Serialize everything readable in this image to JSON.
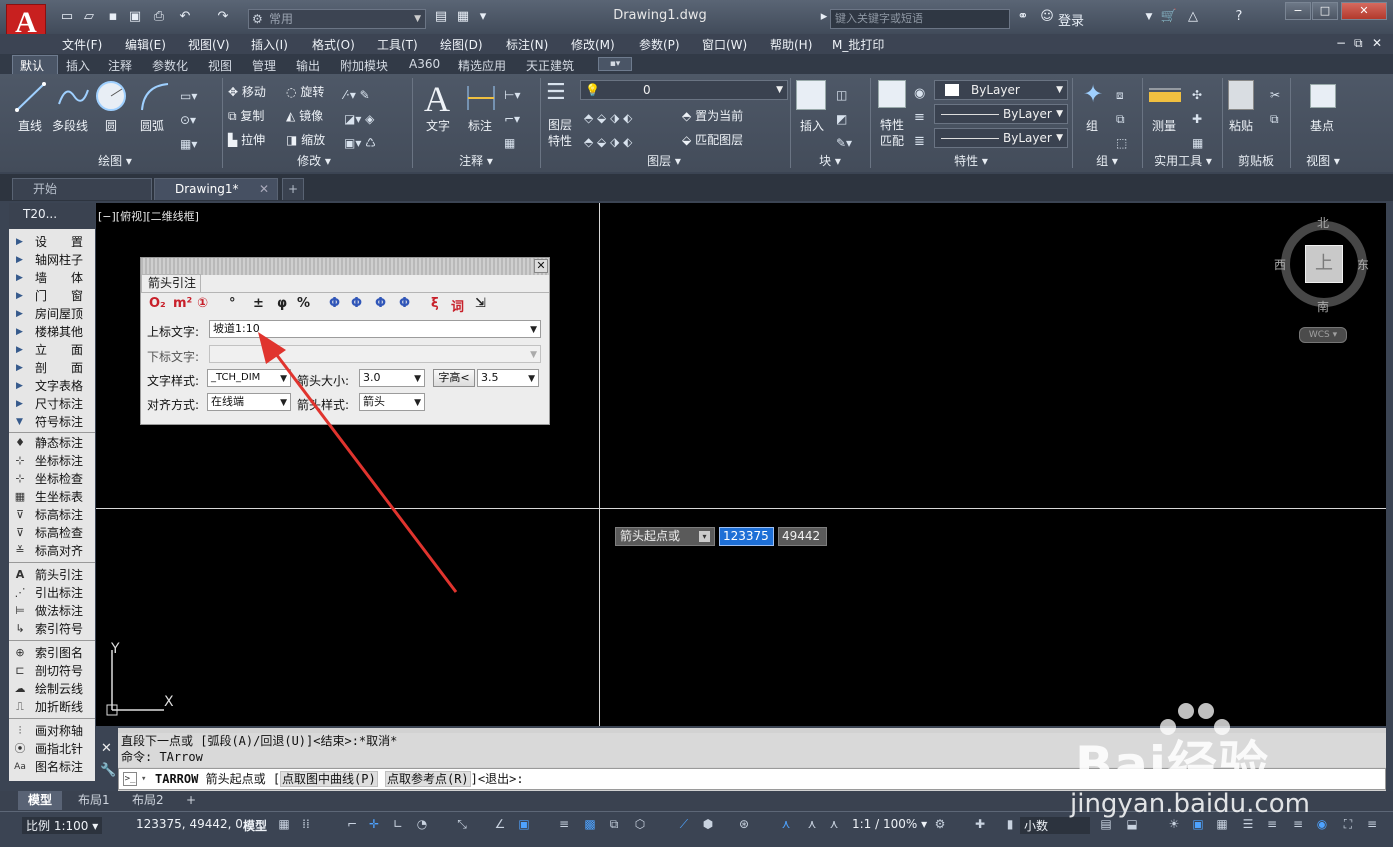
{
  "window": {
    "title": "Drawing1.dwg",
    "workspace": "常用",
    "search_placeholder": "键入关键字或短语",
    "login": "登录"
  },
  "menu": [
    "文件(F)",
    "编辑(E)",
    "视图(V)",
    "插入(I)",
    "格式(O)",
    "工具(T)",
    "绘图(D)",
    "标注(N)",
    "修改(M)",
    "参数(P)",
    "窗口(W)",
    "帮助(H)",
    "M_批打印"
  ],
  "ribbon_tabs": [
    "默认",
    "插入",
    "注释",
    "参数化",
    "视图",
    "管理",
    "输出",
    "附加模块",
    "A360",
    "精选应用",
    "天正建筑"
  ],
  "ribbon": {
    "draw": {
      "line": "直线",
      "polyline": "多段线",
      "circle": "圆",
      "arc": "圆弧",
      "panel": "绘图 ▾"
    },
    "modify": {
      "move": "移动",
      "rotate": "旋转",
      "copy": "复制",
      "mirror": "镜像",
      "stretch": "拉伸",
      "scale": "缩放",
      "panel": "修改 ▾"
    },
    "annot": {
      "text": "文字",
      "dim": "标注",
      "panel": "注释 ▾"
    },
    "layers": {
      "props": "图层\n特性",
      "current_layer": "0",
      "set_current": "置为当前",
      "match_layer": "匹配图层",
      "panel": "图层 ▾"
    },
    "block": {
      "insert": "插入",
      "panel": "块 ▾"
    },
    "properties": {
      "match": "特性\n匹配",
      "color": "ByLayer",
      "linetype": "ByLayer",
      "lineweight": "ByLayer",
      "panel": "特性 ▾"
    },
    "group": {
      "group": "组",
      "panel": "组 ▾"
    },
    "utilities": {
      "measure": "测量",
      "panel": "实用工具 ▾"
    },
    "clipboard": {
      "paste": "粘贴",
      "panel": "剪贴板"
    },
    "view": {
      "base": "基点",
      "panel": "视图 ▾"
    }
  },
  "doc_tabs": [
    "开始",
    "Drawing1*"
  ],
  "viewport_label": "[−][俯视][二维线框]",
  "palette": {
    "header": "T20...",
    "groups": [
      "设　　置",
      "轴网柱子",
      "墙　　体",
      "门　　窗",
      "房间屋顶",
      "楼梯其他",
      "立　　面",
      "剖　　面",
      "文字表格",
      "尺寸标注",
      "符号标注"
    ],
    "tools1": [
      "静态标注",
      "坐标标注",
      "坐标检查",
      "生坐标表",
      "标高标注",
      "标高检查",
      "标高对齐"
    ],
    "tools2": [
      "箭头引注",
      "引出标注",
      "做法标注",
      "索引符号"
    ],
    "tools3": [
      "索引图名",
      "剖切符号",
      "绘制云线",
      "加折断线"
    ],
    "tools4": [
      "画对称轴",
      "画指北针",
      "图名标注"
    ]
  },
  "dialog": {
    "title": "箭头引注",
    "symbols": [
      "O₂",
      "m²",
      "①",
      "°",
      "±",
      "φ",
      "%",
      "Φ",
      "Φ",
      "Φ",
      "Φ",
      "ξ",
      "词",
      "⇲"
    ],
    "upper_label": "上标文字:",
    "upper_value": "坡道1:10",
    "lower_label": "下标文字:",
    "lower_value": "",
    "text_style_label": "文字样式:",
    "text_style": "_TCH_DIM",
    "arrow_size_label": "箭头大小:",
    "arrow_size": "3.0",
    "font_height_btn": "字高<",
    "font_height": "3.5",
    "align_label": "对齐方式:",
    "align": "在线端",
    "arrow_style_label": "箭头样式:",
    "arrow_style": "箭头"
  },
  "cursor_tip": {
    "prompt": "箭头起点或",
    "x": "123375",
    "y": "49442"
  },
  "viewcube": {
    "n": "北",
    "s": "南",
    "e": "东",
    "w": "西",
    "face": "上",
    "wcs": "WCS ▾"
  },
  "ucs": {
    "x": "X",
    "y": "Y"
  },
  "command": {
    "history": [
      "直段下一点或 [弧段(A)/回退(U)]<结束>:*取消*",
      "命令: TArrow"
    ],
    "prompt_cmd": "TARROW",
    "prompt_text": "箭头起点或 [",
    "opt1": "点取图中曲线(P)",
    "opt2": "点取参考点(R)",
    "prompt_end": "]<退出>:"
  },
  "model_tabs": [
    "模型",
    "布局1",
    "布局2"
  ],
  "status": {
    "scale": "比例 1:100 ▾",
    "coords": "123375, 49442, 0",
    "model": "模型",
    "zoom": "1:1 / 100% ▾",
    "units": "小数"
  },
  "watermark": {
    "brand": "Bai经验",
    "url": "jingyan.baidu.com"
  },
  "colors": {
    "accent": "#1e6fd6",
    "logo": "#c8201f",
    "arrow": "#e0342e"
  }
}
